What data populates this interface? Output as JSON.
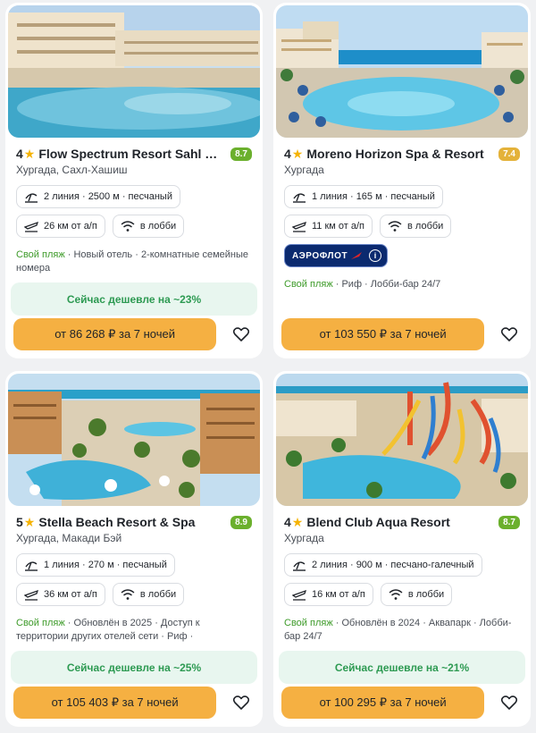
{
  "hotels": [
    {
      "stars": "4",
      "name": "Flow Spectrum Resort Sahl Hasheesh",
      "rating": "8.7",
      "location": "Хургада, Сахл-Хашиш",
      "beach": "2 линия · 2500 м · песчаный",
      "airport": "26 км от а/п",
      "wifi": "в лобби",
      "highlight": "Свой пляж",
      "features_rest": " · Новый отель · 2-комнатные семейные номера",
      "deal": "Сейчас дешевле на ~23%",
      "price": "от 86 268 ₽ за 7 ночей"
    },
    {
      "stars": "4",
      "name": "Moreno Horizon Spa & Resort",
      "rating": "7.4",
      "location": "Хургада",
      "beach": "1 линия · 165 м · песчаный",
      "airport": "11 км от а/п",
      "wifi": "в лобби",
      "airline": "АЭРОФЛОТ",
      "highlight": "Свой пляж",
      "features_rest": " · Риф · Лобби-бар 24/7",
      "price": "от 103 550 ₽ за 7 ночей"
    },
    {
      "stars": "5",
      "name": "Stella Beach Resort & Spa",
      "rating": "8.9",
      "location": "Хургада, Макади Бэй",
      "beach": "1 линия · 270 м · песчаный",
      "airport": "36 км от а/п",
      "wifi": "в лобби",
      "highlight": "Свой пляж",
      "features_rest": " · Обновлён в 2025 · Доступ к территории других отелей сети · Риф ·",
      "deal": "Сейчас дешевле на ~25%",
      "price": "от 105 403 ₽ за 7 ночей"
    },
    {
      "stars": "4",
      "name": "Blend Club Aqua Resort",
      "rating": "8.7",
      "location": "Хургада",
      "beach": "2 линия · 900 м · песчано-галечный",
      "airport": "16 км от а/п",
      "wifi": "в лобби",
      "highlight": "Свой пляж",
      "features_rest": " · Обновлён в 2024 · Аквапарк · Лобби-бар 24/7",
      "deal": "Сейчас дешевле на ~21%",
      "price": "от 100 295 ₽ за 7 ночей"
    }
  ],
  "colors": {
    "accent": "#f5b042",
    "rating_good": "#6bb02d",
    "rating_mid": "#e4b23a",
    "deal_text": "#2d9a52",
    "deal_bg": "#e8f6ef",
    "airline_bg": "#0b2a6f"
  },
  "icons": {
    "beach": "umbrella-icon",
    "airport": "plane-icon",
    "wifi": "wifi-icon",
    "favorite": "heart-icon",
    "star": "star-icon"
  }
}
